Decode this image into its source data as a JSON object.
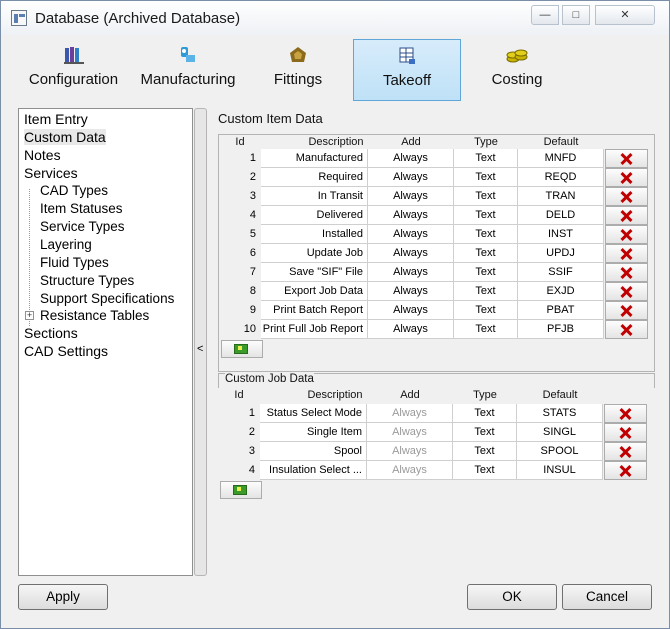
{
  "window": {
    "title": "Database (Archived Database)",
    "minimize_glyph": "—",
    "maximize_glyph": "□",
    "close_glyph": "✕"
  },
  "tabs": [
    {
      "label": "Configuration",
      "icon": "books-icon",
      "selected": false
    },
    {
      "label": "Manufacturing",
      "icon": "wrench-icon",
      "selected": false
    },
    {
      "label": "Fittings",
      "icon": "fitting-icon",
      "selected": false
    },
    {
      "label": "Takeoff",
      "icon": "takeoff-icon",
      "selected": true
    },
    {
      "label": "Costing",
      "icon": "coins-icon",
      "selected": false
    }
  ],
  "tree": {
    "items": [
      {
        "label": "Item Entry"
      },
      {
        "label": "Custom Data",
        "selected": true
      },
      {
        "label": "Notes"
      },
      {
        "label": "Services"
      },
      {
        "label": "CAD Types"
      },
      {
        "label": "Item Statuses"
      },
      {
        "label": "Service Types"
      },
      {
        "label": "Layering"
      },
      {
        "label": "Fluid Types"
      },
      {
        "label": "Structure Types"
      },
      {
        "label": "Support Specifications"
      },
      {
        "label": "Resistance Tables",
        "expander": "+"
      },
      {
        "label": "Sections"
      },
      {
        "label": "CAD Settings"
      }
    ]
  },
  "splitter_arrow": "<",
  "custom_item_data": {
    "title": "Custom Item Data",
    "columns": {
      "id": "Id",
      "description": "Description",
      "add": "Add",
      "type": "Type",
      "default": "Default"
    },
    "rows": [
      {
        "id": "1",
        "description": "Manufactured",
        "add": "Always",
        "type": "Text",
        "default": "MNFD"
      },
      {
        "id": "2",
        "description": "Required",
        "add": "Always",
        "type": "Text",
        "default": "REQD"
      },
      {
        "id": "3",
        "description": "In Transit",
        "add": "Always",
        "type": "Text",
        "default": "TRAN"
      },
      {
        "id": "4",
        "description": "Delivered",
        "add": "Always",
        "type": "Text",
        "default": "DELD"
      },
      {
        "id": "5",
        "description": "Installed",
        "add": "Always",
        "type": "Text",
        "default": "INST"
      },
      {
        "id": "6",
        "description": "Update Job",
        "add": "Always",
        "type": "Text",
        "default": "UPDJ"
      },
      {
        "id": "7",
        "description": "Save \"SIF\" File",
        "add": "Always",
        "type": "Text",
        "default": "SSIF"
      },
      {
        "id": "8",
        "description": "Export Job Data",
        "add": "Always",
        "type": "Text",
        "default": "EXJD"
      },
      {
        "id": "9",
        "description": "Print Batch Report",
        "add": "Always",
        "type": "Text",
        "default": "PBAT"
      },
      {
        "id": "10",
        "description": "Print Full Job Report",
        "add": "Always",
        "type": "Text",
        "default": "PFJB"
      }
    ]
  },
  "custom_job_data": {
    "title": "Custom Job Data",
    "columns": {
      "id": "Id",
      "description": "Description",
      "add": "Add",
      "type": "Type",
      "default": "Default"
    },
    "rows": [
      {
        "id": "1",
        "description": "Status Select Mode",
        "add": "Always",
        "type": "Text",
        "default": "STATS"
      },
      {
        "id": "2",
        "description": "Single Item",
        "add": "Always",
        "type": "Text",
        "default": "SINGL"
      },
      {
        "id": "3",
        "description": "Spool",
        "add": "Always",
        "type": "Text",
        "default": "SPOOL"
      },
      {
        "id": "4",
        "description": "Insulation Select ...",
        "add": "Always",
        "type": "Text",
        "default": "INSUL"
      }
    ]
  },
  "buttons": {
    "apply": "Apply",
    "ok": "OK",
    "cancel": "Cancel"
  },
  "colors": {
    "selected_tab": "#c4e3f8",
    "delete_x": "#c00000",
    "add_green": "#3a9b2b"
  }
}
